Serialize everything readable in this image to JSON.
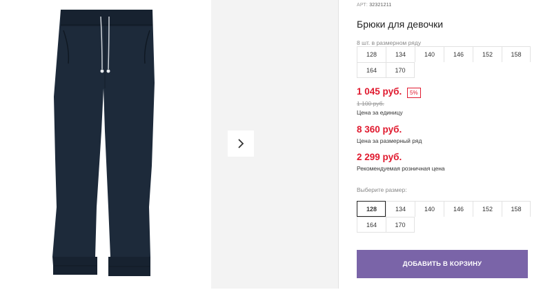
{
  "product": {
    "art_label": "АРТ:",
    "art_number": "32321211",
    "title": "Брюки для девочки",
    "size_hint": "8 шт. в размерном ряду"
  },
  "size_row": [
    "128",
    "134",
    "140",
    "146",
    "152",
    "158",
    "164",
    "170"
  ],
  "pricing": {
    "unit_price": "1 045 руб.",
    "discount_badge": "5%",
    "old_price": "1 100 руб.",
    "unit_caption": "Цена за единицу",
    "row_price": "8 360 руб.",
    "row_caption": "Цена за размерный ряд",
    "retail_price": "2 299 руб.",
    "retail_caption": "Рекомендуемая розничная цена"
  },
  "size_select": {
    "label": "Выберите размер:",
    "selected": "128",
    "options": [
      "128",
      "134",
      "140",
      "146",
      "152",
      "158",
      "164",
      "170"
    ]
  },
  "cart_button": "ДОБАВИТЬ В КОРЗИНУ",
  "icons": {
    "next": "chevron-right-icon"
  },
  "colors": {
    "accent_red": "#e0192e",
    "cart_button": "#7a64a8",
    "pants": "#1d2a3a"
  }
}
